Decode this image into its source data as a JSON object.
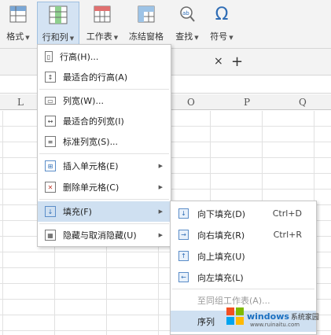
{
  "ribbon": {
    "format_label": "格式",
    "rowcol_label": "行和列",
    "worksheet_label": "工作表",
    "freeze_label": "冻结窗格",
    "find_label": "查找",
    "symbol_label": "符号",
    "symbol_glyph": "Ω"
  },
  "tabs": {
    "close_glyph": "×",
    "add_glyph": "+"
  },
  "columns": {
    "l": "L",
    "o": "O",
    "p": "P",
    "q": "Q"
  },
  "menu": {
    "items": [
      {
        "label": "行高(H)..."
      },
      {
        "label": "最适合的行高(A)"
      },
      {
        "label": "列宽(W)..."
      },
      {
        "label": "最适合的列宽(I)"
      },
      {
        "label": "标准列宽(S)..."
      },
      {
        "label": "插入单元格(E)"
      },
      {
        "label": "删除单元格(C)"
      },
      {
        "label": "填充(F)"
      },
      {
        "label": "隐藏与取消隐藏(U)"
      }
    ]
  },
  "submenu": {
    "items": [
      {
        "label": "向下填充(D)",
        "shortcut": "Ctrl+D"
      },
      {
        "label": "向右填充(R)",
        "shortcut": "Ctrl+R"
      },
      {
        "label": "向上填充(U)",
        "shortcut": ""
      },
      {
        "label": "向左填充(L)",
        "shortcut": ""
      },
      {
        "label": "至同组工作表(A)...",
        "shortcut": ""
      },
      {
        "label": "序列",
        "shortcut": ""
      }
    ]
  },
  "watermark": {
    "brand": "windows",
    "suffix": "系统家园",
    "url": "www.ruinaitu.com"
  },
  "colors": {
    "accent": "#2f6db5",
    "highlight": "#cfe0f1",
    "ribbon_bg": "#f3f3f3"
  }
}
